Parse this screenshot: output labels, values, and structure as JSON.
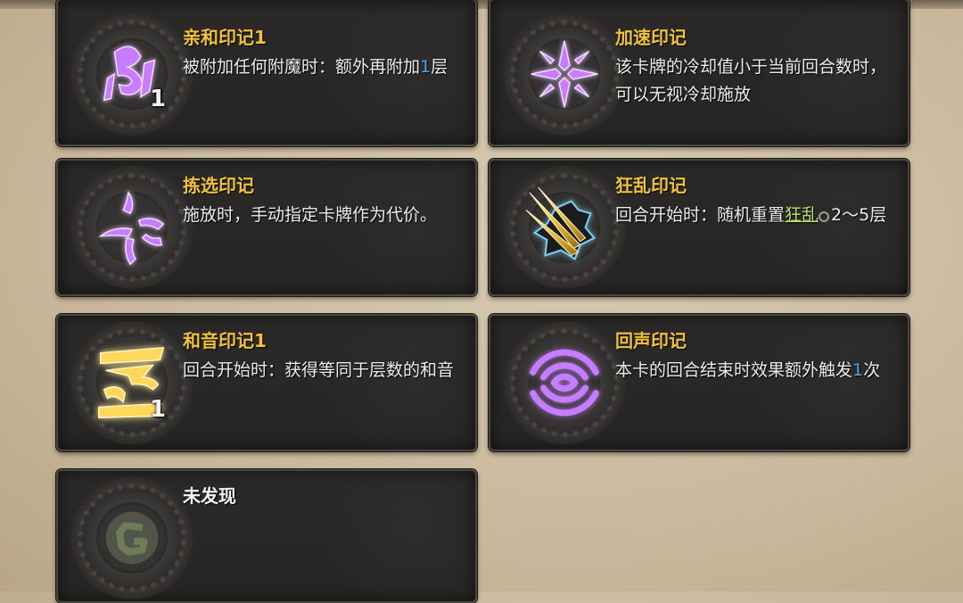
{
  "cards": [
    {
      "title": "亲和印记1",
      "level": "1",
      "desc_a": "被附加任何附魔时：额外再附加",
      "num": "1",
      "desc_b": "层",
      "icon": "purple-rune-icon"
    },
    {
      "title": "加速印记",
      "desc": "该卡牌的冷却值小于当前回合数时，可以无视冷却施放",
      "icon": "purple-star-rune-icon"
    },
    {
      "title": "拣选印记",
      "desc": "施放时，手动指定卡牌作为代价。",
      "icon": "purple-glyph-icon"
    },
    {
      "title": "狂乱印记",
      "desc_a": "回合开始时：随机重置",
      "keyword": "狂乱",
      "desc_b": "2～5层",
      "icon": "golden-claws-icon"
    },
    {
      "title": "和音印记1",
      "level": "1",
      "desc": "回合开始时：获得等同于层数的和音",
      "icon": "golden-harmony-rune-icon"
    },
    {
      "title": "回声印记",
      "desc_a": "本卡的回合结束时效果额外触发",
      "num": "1",
      "desc_b": "次",
      "icon": "purple-echo-waves-icon"
    },
    {
      "title": "未发现",
      "icon": "undiscovered-rune-icon"
    }
  ],
  "colors": {
    "title": "#f0c23c",
    "number": "#4aa3ef",
    "keyword": "#b8e36a",
    "purple": "#c77dff",
    "gold": "#ffd75a"
  }
}
